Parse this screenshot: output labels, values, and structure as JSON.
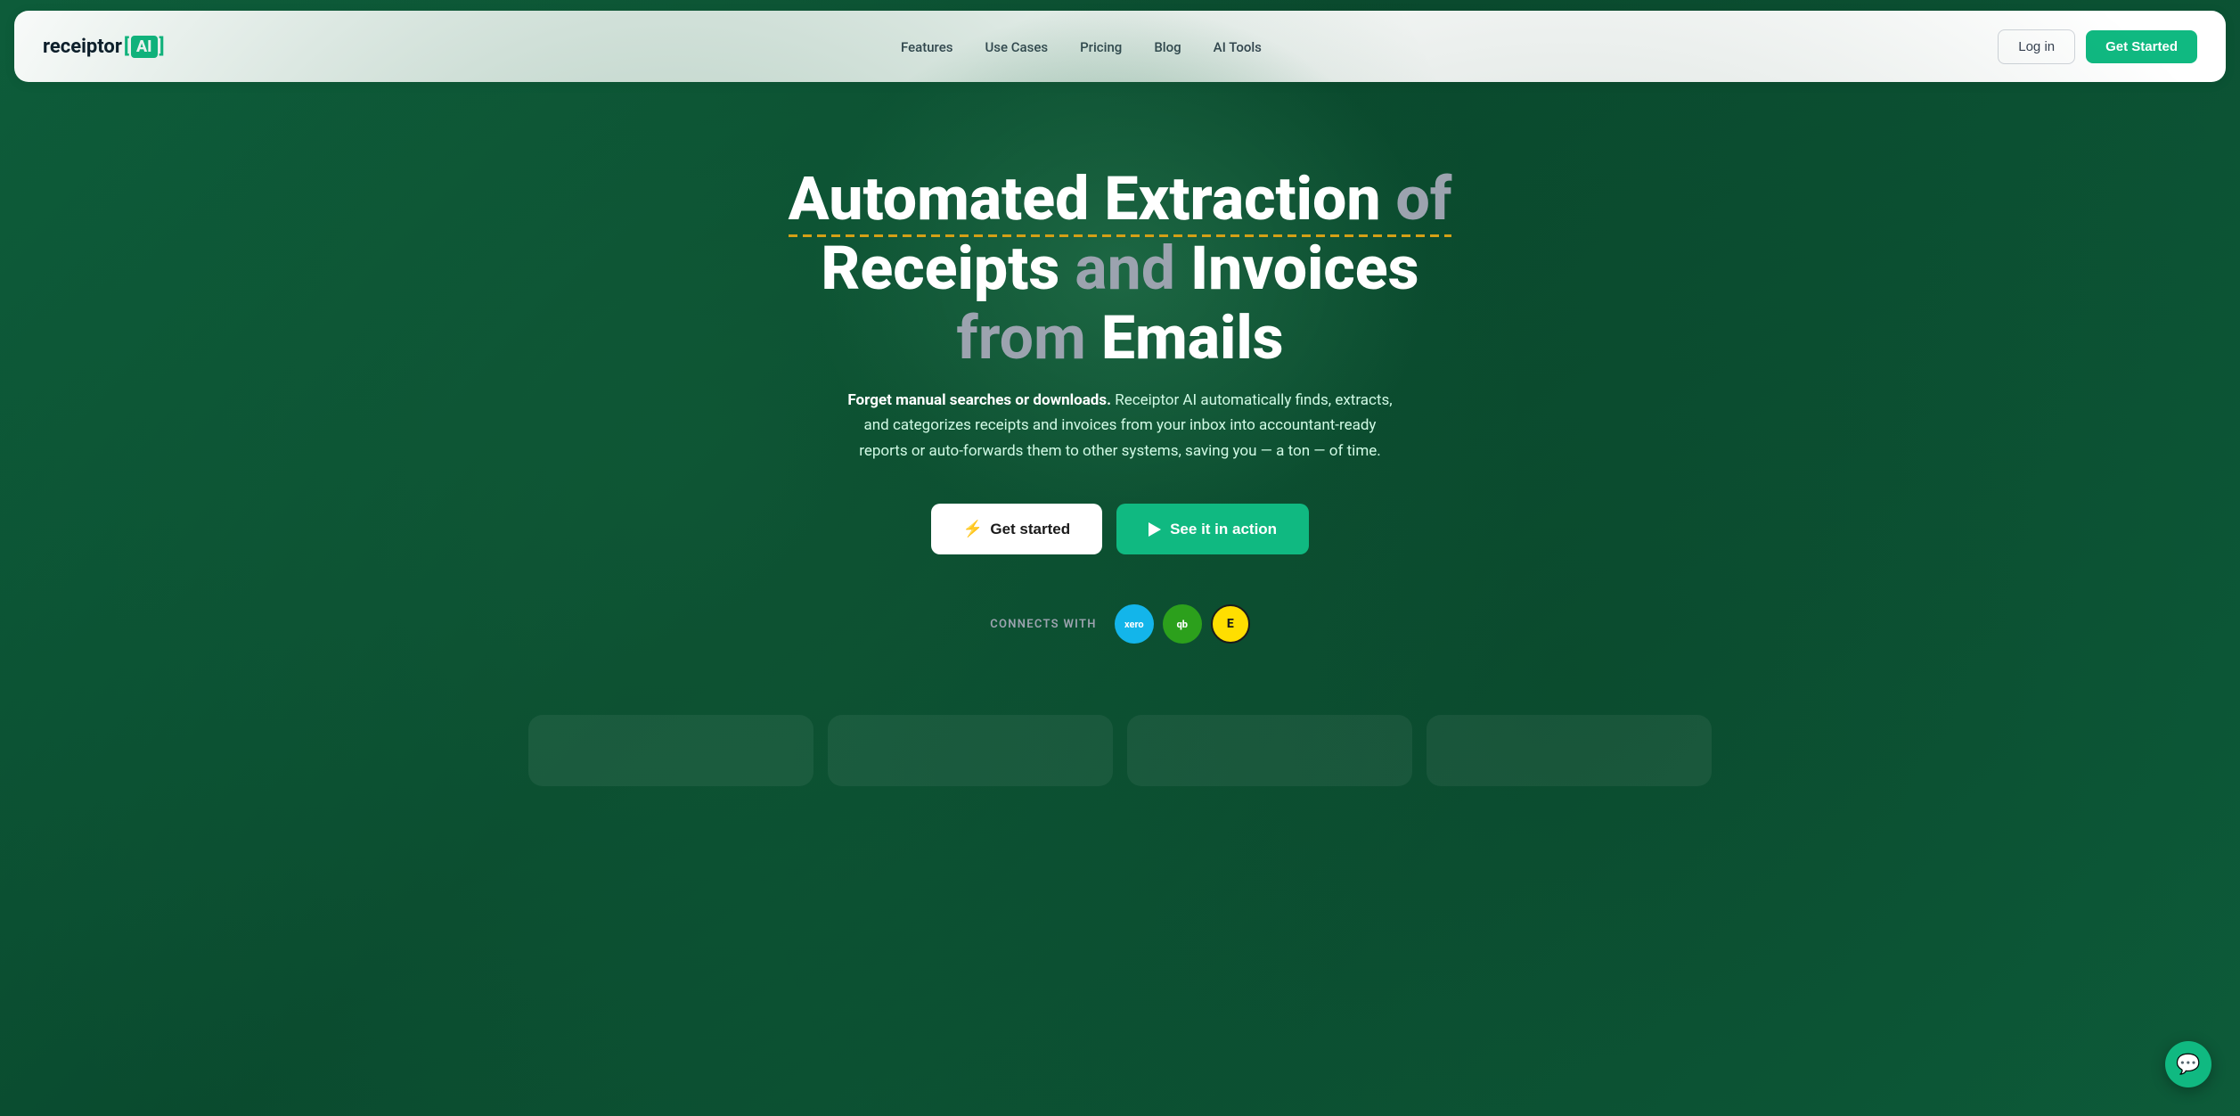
{
  "logo": {
    "text_main": "receiptor",
    "bracket_open": "[",
    "ai_text": "AI",
    "bracket_close": "]"
  },
  "nav": {
    "links": [
      {
        "label": "Features",
        "href": "#"
      },
      {
        "label": "Use Cases",
        "href": "#"
      },
      {
        "label": "Pricing",
        "href": "#"
      },
      {
        "label": "Blog",
        "href": "#"
      },
      {
        "label": "AI Tools",
        "href": "#"
      }
    ],
    "login_label": "Log in",
    "get_started_label": "Get Started"
  },
  "hero": {
    "title_line1_bold": "Automated Extraction",
    "title_line1_muted": "of",
    "title_line2_bold1": "Receipts",
    "title_line2_muted": "and",
    "title_line2_bold2": "Invoices",
    "title_line3_muted": "from",
    "title_line3_bold": "Emails",
    "subtitle_bold": "Forget manual searches or downloads.",
    "subtitle_rest": " Receiptor AI automatically finds, extracts, and categorizes receipts and invoices from your inbox into accountant-ready reports or auto-forwards them to other systems, saving you — a ton — of time.",
    "btn_get_started": "Get started",
    "btn_see_action": "See it in action",
    "connects_label": "CONNECTS WITH",
    "connects": [
      {
        "name": "xero",
        "text": "xero"
      },
      {
        "name": "quickbooks",
        "text": "qb"
      },
      {
        "name": "expensify",
        "text": "E"
      }
    ]
  },
  "chat": {
    "icon": "💬"
  }
}
